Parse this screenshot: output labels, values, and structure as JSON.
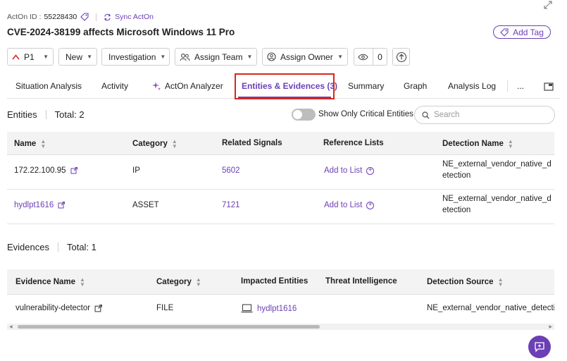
{
  "header": {
    "acton_id_label": "ActOn ID :",
    "acton_id_value": "55228430",
    "sync_label": "Sync ActOn",
    "title": "CVE-2024-38199 affects Microsoft Windows 11 Pro",
    "add_tag_label": "Add Tag"
  },
  "toolbar": {
    "priority": "P1",
    "status": "New",
    "stage": "Investigation",
    "assign_team": "Assign Team",
    "assign_owner": "Assign Owner",
    "watchers_count": "0"
  },
  "tabs": [
    {
      "label": "Situation Analysis"
    },
    {
      "label": "Activity"
    },
    {
      "label": "ActOn Analyzer"
    },
    {
      "label": "Entities & Evidences (3)"
    },
    {
      "label": "Summary"
    },
    {
      "label": "Graph"
    },
    {
      "label": "Analysis Log"
    },
    {
      "label": "..."
    }
  ],
  "entities": {
    "heading": "Entities",
    "total": "Total: 2",
    "toggle_label": "Show Only Critical Entities",
    "search_placeholder": "Search",
    "columns": [
      "Name",
      "Category",
      "Related Signals",
      "Reference Lists",
      "Detection Name"
    ],
    "rows": [
      {
        "name": "172.22.100.95",
        "category": "IP",
        "signals": "5602",
        "ref": "Add to List",
        "detection_line1": "NE_external_vendor_native_d",
        "detection_line2": "etection"
      },
      {
        "name": "hydlpt1616",
        "category": "ASSET",
        "signals": "7121",
        "ref": "Add to List",
        "detection_line1": "NE_external_vendor_native_d",
        "detection_line2": "etection"
      }
    ]
  },
  "evidences": {
    "heading": "Evidences",
    "total": "Total: 1",
    "columns": [
      "Evidence Name",
      "Category",
      "Impacted Entities",
      "Threat Intelligence",
      "Detection Source"
    ],
    "rows": [
      {
        "name": "vulnerability-detector",
        "category": "FILE",
        "impacted": "hydlpt1616",
        "threat": "",
        "source": "NE_external_vendor_native_detection"
      }
    ]
  },
  "colors": {
    "accent": "#6b3fb5",
    "highlight": "#d9261c",
    "priority": "#d9261c"
  }
}
